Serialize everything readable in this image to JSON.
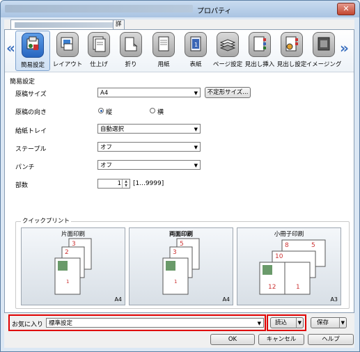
{
  "window": {
    "title": "プロパティ",
    "close_glyph": "✕"
  },
  "tabs": [
    {
      "label": ""
    },
    {
      "label": "詳細設定"
    }
  ],
  "categories": [
    {
      "label": "簡易設定",
      "icon": "basic-settings-icon"
    },
    {
      "label": "レイアウト",
      "icon": "layout-icon"
    },
    {
      "label": "仕上げ",
      "icon": "finishing-icon"
    },
    {
      "label": "折り",
      "icon": "fold-icon"
    },
    {
      "label": "用紙",
      "icon": "paper-icon"
    },
    {
      "label": "表紙",
      "icon": "cover-icon"
    },
    {
      "label": "ページ設定",
      "icon": "page-setup-icon"
    },
    {
      "label": "見出し挿入",
      "icon": "tab-insert-icon"
    },
    {
      "label": "見出し設定",
      "icon": "tab-settings-icon"
    },
    {
      "label": "イメージング",
      "icon": "imaging-icon"
    }
  ],
  "basic": {
    "section_title": "簡易設定",
    "original_size_label": "原稿サイズ",
    "original_size_value": "A4",
    "custom_size_button": "不定形サイズ...",
    "orientation_label": "原稿の向き",
    "orientation_portrait": "縦",
    "orientation_landscape": "横",
    "paper_tray_label": "給紙トレイ",
    "paper_tray_value": "自動選択",
    "staple_label": "ステープル",
    "staple_value": "オフ",
    "punch_label": "パンチ",
    "punch_value": "オフ",
    "copies_label": "部数",
    "copies_value": "1",
    "copies_range": "[1...9999]"
  },
  "quick_print": {
    "title": "クイックプリント",
    "presets": [
      {
        "name": "片面印刷",
        "paper": "A4"
      },
      {
        "name": "両面印刷",
        "paper": "A4"
      },
      {
        "name": "小冊子印刷",
        "paper": "A3"
      }
    ]
  },
  "favorites": {
    "label": "お気に入り",
    "value": "標準設定",
    "load_button": "読込",
    "save_button": "保存"
  },
  "dialog_buttons": {
    "ok": "OK",
    "cancel": "キャンセル",
    "help": "ヘルプ"
  },
  "colors": {
    "accent": "#2b62b0",
    "highlight_frame": "#e00000"
  }
}
